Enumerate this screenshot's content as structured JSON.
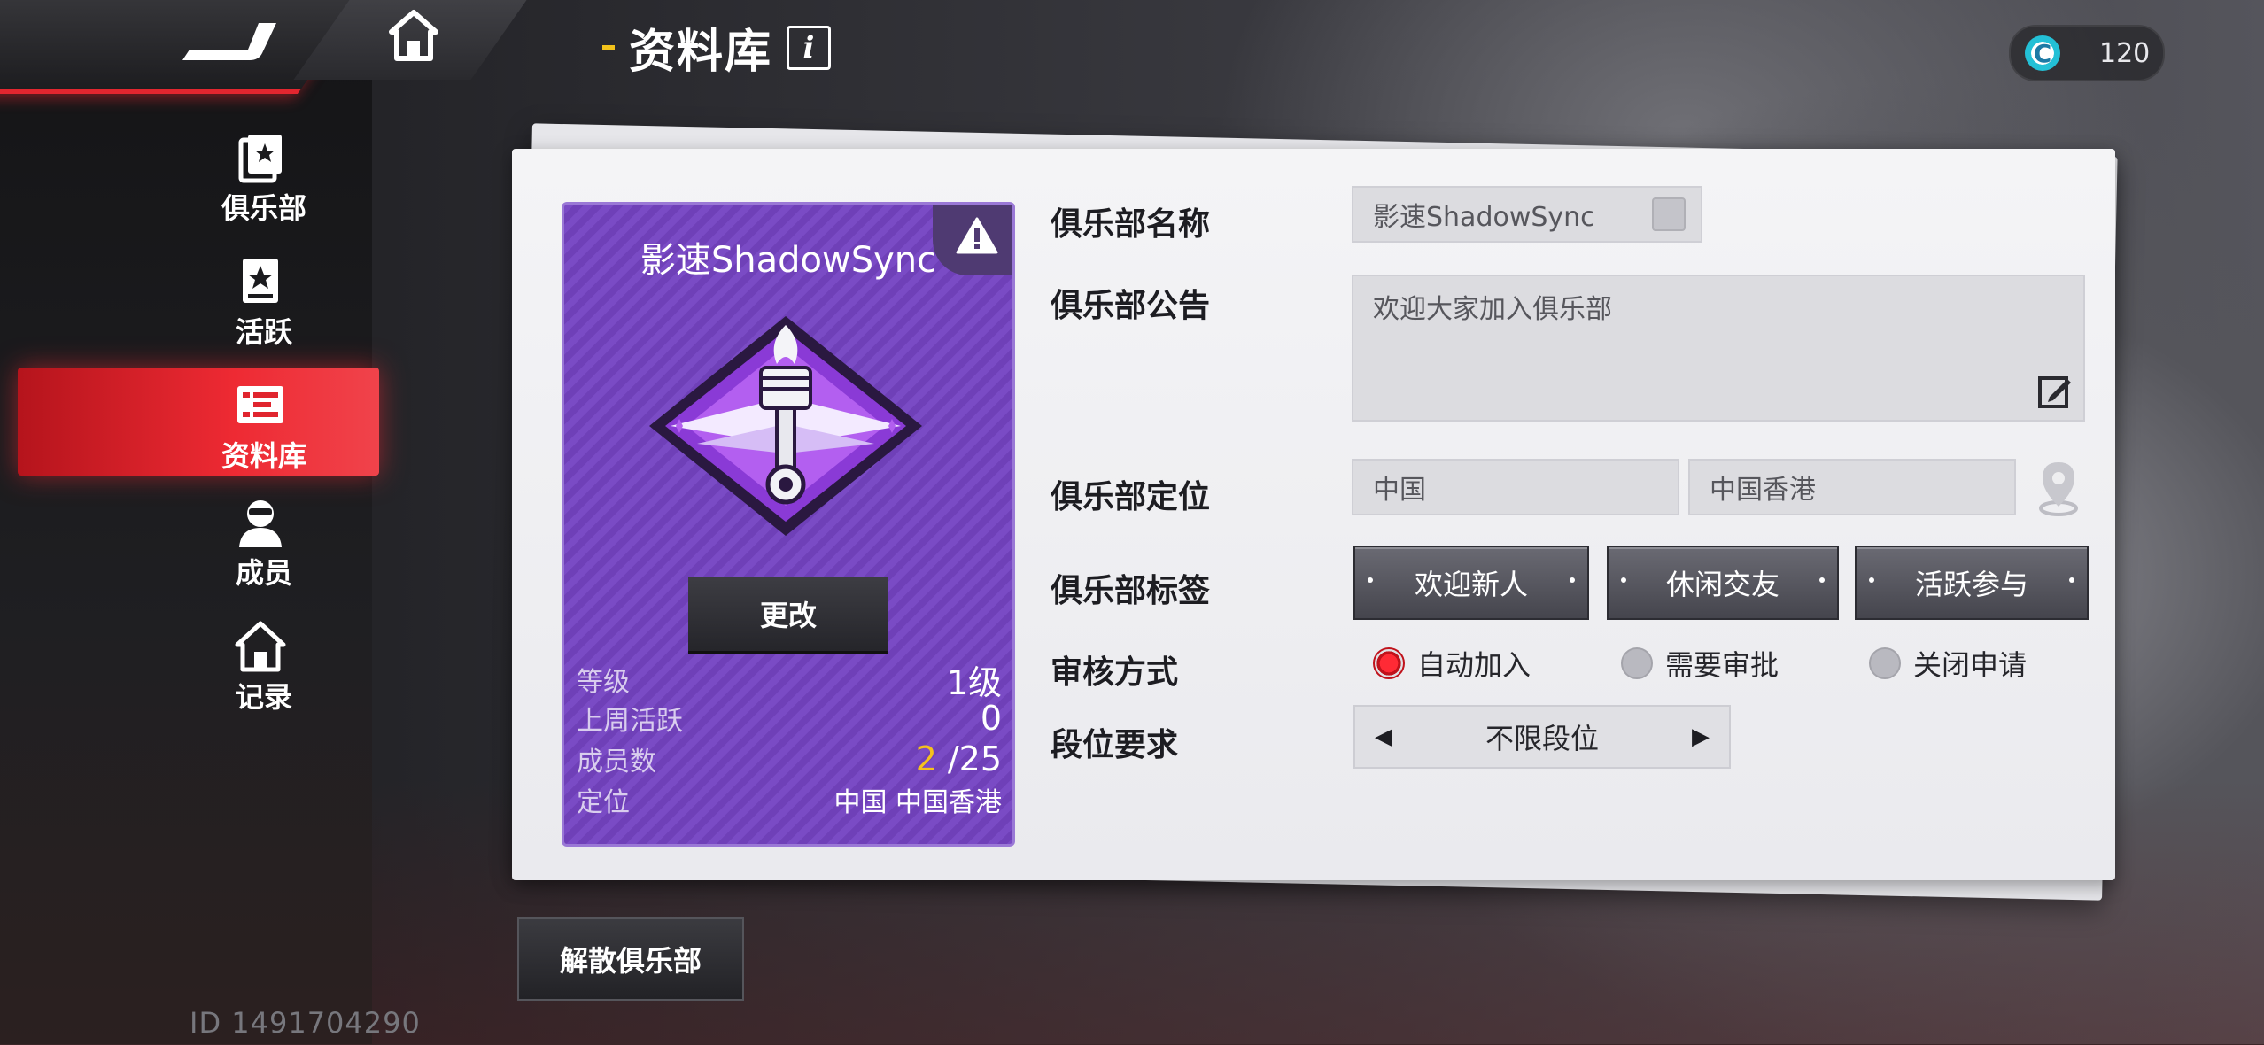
{
  "header": {
    "title": "资料库",
    "info_icon": "i",
    "currency": {
      "icon": "C",
      "value": "120",
      "accent": "#23c0d6"
    }
  },
  "sidebar": {
    "items": [
      {
        "label": "俱乐部",
        "icon": "club-card-icon",
        "active": false
      },
      {
        "label": "活跃",
        "icon": "star-card-icon",
        "active": false
      },
      {
        "label": "资料库",
        "icon": "list-icon",
        "active": true
      },
      {
        "label": "成员",
        "icon": "member-icon",
        "active": false
      },
      {
        "label": "记录",
        "icon": "home-record-icon",
        "active": false
      }
    ],
    "active_color": "#ee2a33"
  },
  "club_card": {
    "name": "影速ShadowSync",
    "change_label": "更改",
    "stats": {
      "level_label": "等级",
      "level_value": "1级",
      "weekly_label": "上周活跃",
      "weekly_value": "0",
      "members_label": "成员数",
      "members_current": "2",
      "members_max": "/25",
      "location_label": "定位",
      "location_value": "中国 中国香港"
    }
  },
  "form": {
    "name_label": "俱乐部名称",
    "name_value": "影速ShadowSync",
    "notice_label": "俱乐部公告",
    "notice_value": "欢迎大家加入俱乐部",
    "location_label": "俱乐部定位",
    "country": "中国",
    "region": "中国香港",
    "tags_label": "俱乐部标签",
    "tags": [
      "欢迎新人",
      "休闲交友",
      "活跃参与"
    ],
    "review_label": "审核方式",
    "review_options": [
      {
        "label": "自动加入",
        "selected": true
      },
      {
        "label": "需要审批",
        "selected": false
      },
      {
        "label": "关闭申请",
        "selected": false
      }
    ],
    "rank_label": "段位要求",
    "rank_value": "不限段位"
  },
  "footer": {
    "disband_label": "解散俱乐部",
    "club_id": "ID 1491704290"
  }
}
